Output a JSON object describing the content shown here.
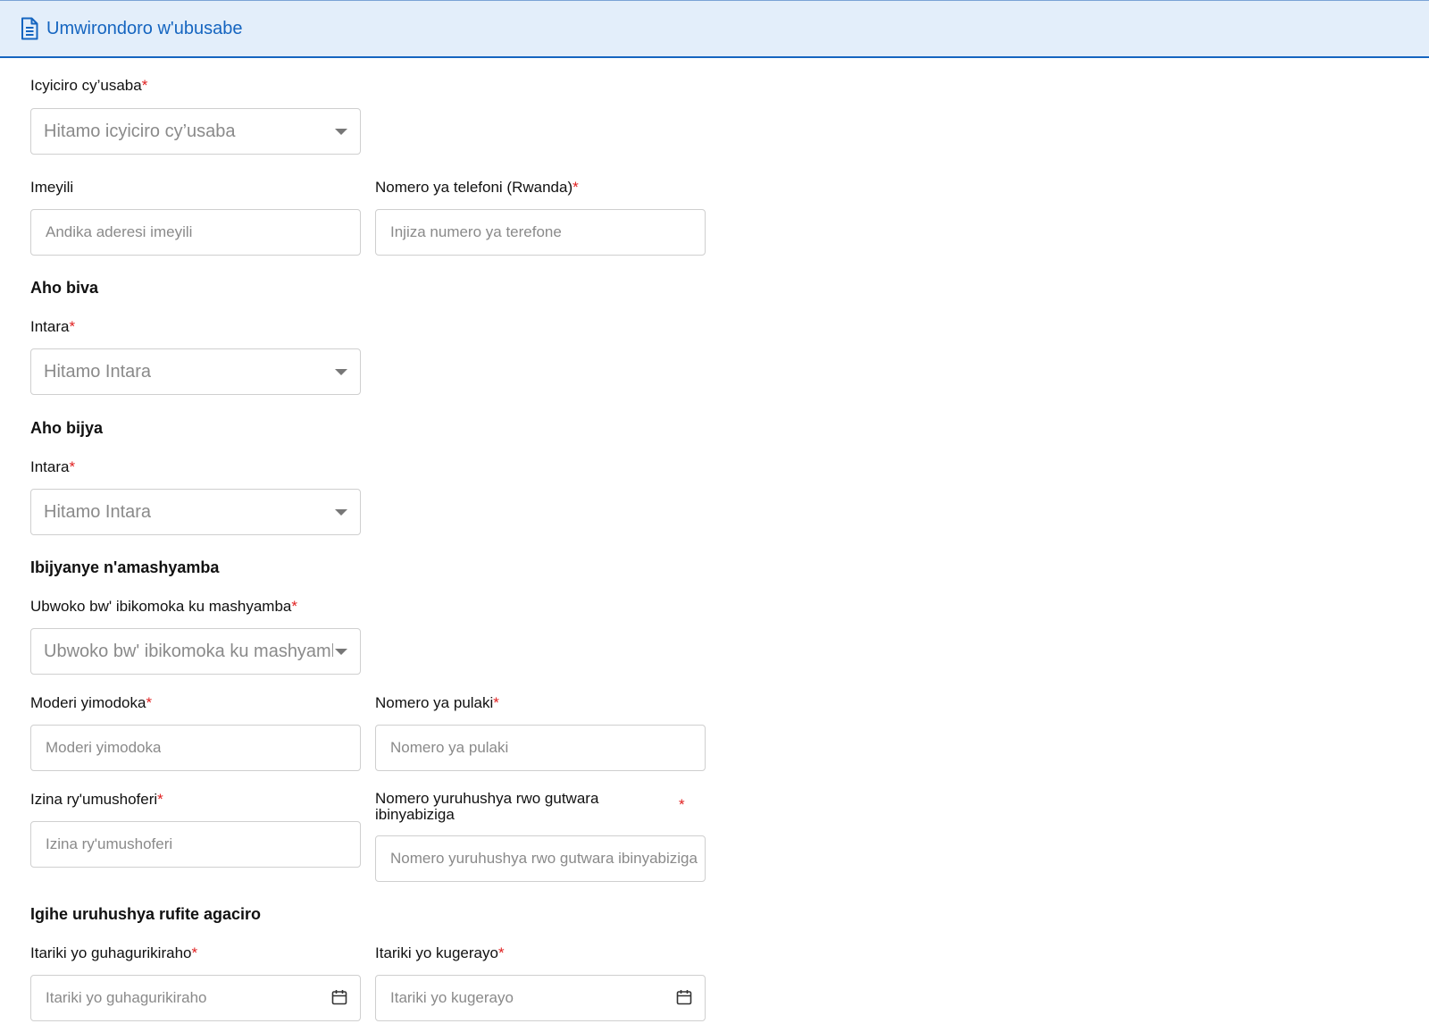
{
  "header": {
    "title": "Umwirondoro w'ubusabe",
    "icon": "document-icon"
  },
  "req_mark": "*",
  "fields": {
    "branch": {
      "label": "Icyiciro cy’usaba",
      "placeholder": "Hitamo icyiciro cy’usaba"
    },
    "email": {
      "label": "Imeyili",
      "placeholder": "Andika aderesi imeyili"
    },
    "phone": {
      "label": "Nomero ya telefoni (Rwanda)",
      "placeholder": "Injiza numero ya terefone"
    },
    "origin_province": {
      "label": "Intara",
      "placeholder": "Hitamo Intara"
    },
    "destination_province": {
      "label": "Intara",
      "placeholder": "Hitamo Intara"
    },
    "product_type": {
      "label": "Ubwoko bw' ibikomoka ku mashyamba",
      "placeholder": "Ubwoko bw' ibikomoka ku mashyamba"
    },
    "vehicle_model": {
      "label": "Moderi yimodoka",
      "placeholder": "Moderi yimodoka"
    },
    "plate_number": {
      "label": "Nomero ya pulaki",
      "placeholder": "Nomero ya pulaki"
    },
    "driver_name": {
      "label": "Izina ry'umushoferi",
      "placeholder": "Izina ry'umushoferi"
    },
    "license_number": {
      "label": "Nomero yuruhushya rwo gutwara ibinyabiziga",
      "placeholder": "Nomero yuruhushya rwo gutwara ibinyabiziga"
    },
    "start_date": {
      "label": "Itariki yo guhagurikiraho",
      "placeholder": "Itariki yo guhagurikiraho"
    },
    "end_date": {
      "label": "Itariki yo kugerayo",
      "placeholder": "Itariki yo kugerayo"
    }
  },
  "sections": {
    "origin": "Aho biva",
    "destination": "Aho bijya",
    "forest_products": "Ibijyanye n'amashyamba",
    "validity": "Igihe uruhushya rufite agaciro"
  },
  "colors": {
    "accent": "#1565c0",
    "header_bg": "#e3eefa",
    "required": "#e02020"
  }
}
